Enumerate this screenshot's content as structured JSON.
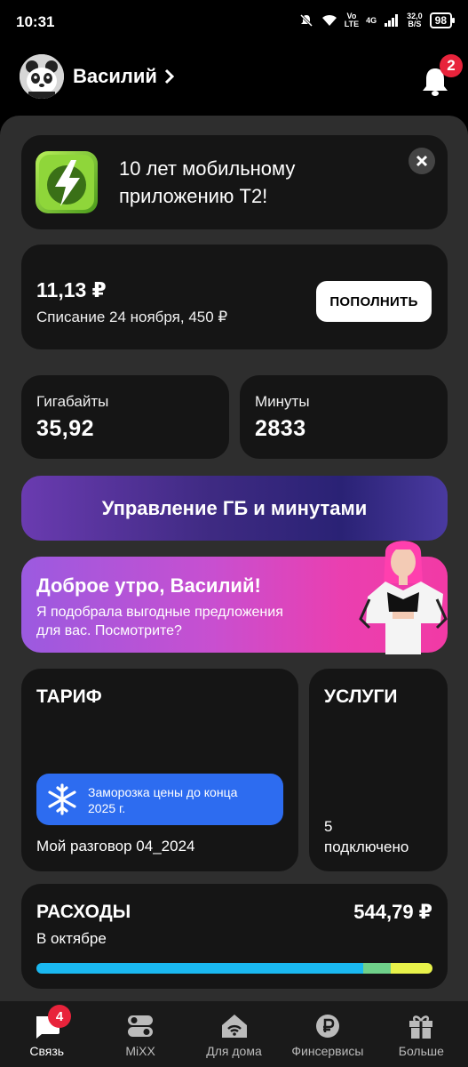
{
  "status_bar": {
    "time": "10:31",
    "network_top": "Vo",
    "network_bottom": "LTE",
    "signal_type": "4G",
    "speed_top": "32,0",
    "speed_bottom": "B/S",
    "battery": "98"
  },
  "header": {
    "user_name": "Василий",
    "notifications_count": "2"
  },
  "promo": {
    "text_line1": "10 лет мобильному",
    "text_line2": "приложению Т2!"
  },
  "balance": {
    "amount": "11,13 ₽",
    "charge_info": "Списание 24 ноября, 450 ₽",
    "topup_label": "ПОПОЛНИТЬ"
  },
  "stats": {
    "gb_label": "Гигабайты",
    "gb_value": "35,92",
    "min_label": "Минуты",
    "min_value": "2833"
  },
  "manage_label": "Управление ГБ и минутами",
  "greeting": {
    "title": "Доброе утро, Василий!",
    "line1": "Я подобрала выгодные предложения",
    "line2": "для вас. Посмотрите?"
  },
  "tariff": {
    "title": "ТАРИФ",
    "freeze_line1": "Заморозка цены до конца",
    "freeze_line2": "2025 г.",
    "name": "Мой разговор 04_2024"
  },
  "services": {
    "title": "УСЛУГИ",
    "count": "5",
    "count_label": "подключено"
  },
  "expenses": {
    "title": "РАСХОДЫ",
    "amount": "544,79 ₽",
    "period": "В октябре",
    "breakdown_fractions": [
      0.825,
      0.07,
      0.105
    ],
    "breakdown_colors": [
      "#1ab8f0",
      "#6fd08a",
      "#e8f24a"
    ]
  },
  "bottom_nav": {
    "items": [
      {
        "label": "Связь",
        "badge": "4"
      },
      {
        "label": "MiXX"
      },
      {
        "label": "Для дома"
      },
      {
        "label": "Финсервисы"
      },
      {
        "label": "Больше"
      }
    ]
  },
  "colors": {
    "accent_blue": "#2d6cf0",
    "badge_red": "#e8233b"
  }
}
